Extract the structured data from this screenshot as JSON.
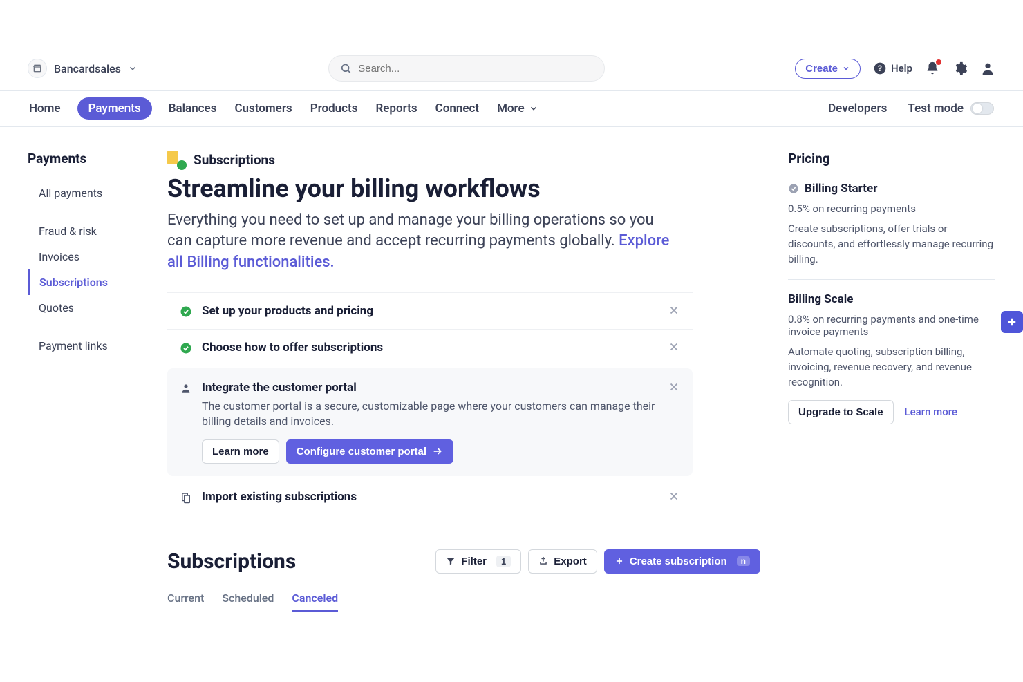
{
  "header": {
    "merchant": "Bancardsales",
    "search_placeholder": "Search...",
    "create_label": "Create",
    "help_label": "Help"
  },
  "nav": {
    "items": [
      "Home",
      "Payments",
      "Balances",
      "Customers",
      "Products",
      "Reports",
      "Connect",
      "More"
    ],
    "active_index": 1,
    "developers": "Developers",
    "test_mode": "Test mode"
  },
  "sidebar": {
    "title": "Payments",
    "items": [
      "All payments",
      "Fraud & risk",
      "Invoices",
      "Subscriptions",
      "Quotes",
      "Payment links"
    ],
    "active_index": 3
  },
  "hero": {
    "eyebrow": "Subscriptions",
    "headline": "Streamline your billing workflows",
    "lead_prefix": "Everything you need to set up and manage your billing operations so you can capture more revenue and accept recurring payments globally. ",
    "lead_link": "Explore all Billing functionalities."
  },
  "steps": [
    {
      "type": "done",
      "title": "Set up your products and pricing"
    },
    {
      "type": "done",
      "title": "Choose how to offer subscriptions"
    },
    {
      "type": "active",
      "title": "Integrate the customer portal",
      "desc": "The customer portal is a secure, customizable page where your customers can manage their billing details and invoices.",
      "learn_more": "Learn more",
      "cta": "Configure customer portal"
    },
    {
      "type": "pending",
      "title": "Import existing subscriptions"
    }
  ],
  "list": {
    "title": "Subscriptions",
    "filter_label": "Filter",
    "filter_count": "1",
    "export_label": "Export",
    "create_label": "Create subscription",
    "create_key": "n",
    "tabs": [
      "Current",
      "Scheduled",
      "Canceled"
    ],
    "active_tab": 2
  },
  "pricing": {
    "title": "Pricing",
    "starter": {
      "name": "Billing Starter",
      "rate": "0.5% on recurring payments",
      "desc": "Create subscriptions, offer trials or discounts, and effortlessly manage recurring billing."
    },
    "scale": {
      "name": "Billing Scale",
      "rate": "0.8% on recurring payments and one-time invoice payments",
      "desc": "Automate quoting, subscription billing, invoicing, revenue recovery, and revenue recognition.",
      "upgrade": "Upgrade to Scale",
      "learn": "Learn more"
    }
  }
}
